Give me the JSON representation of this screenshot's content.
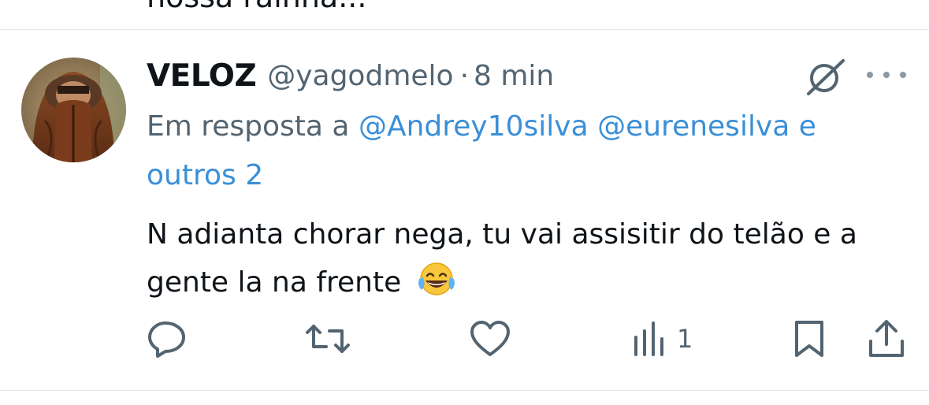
{
  "previous_tweet": {
    "text_fragment": "nossa rainha..."
  },
  "tweet": {
    "author": {
      "display_name": "VELOZ",
      "handle": "@yagodmelo"
    },
    "separator": "·",
    "time": "8 min",
    "reply_prefix": "Em resposta a",
    "reply_mentions": [
      "@Andrey10silva",
      "@eurenesilva"
    ],
    "reply_and": "e",
    "reply_others": "outros 2",
    "text": "N adianta chorar nega, tu vai assisitir do telão e a gente la na frente",
    "text_emoji": "😂"
  },
  "actions": {
    "reply_icon": "reply-bubble-icon",
    "retweet_icon": "retweet-icon",
    "like_icon": "heart-icon",
    "views_icon": "views-bar-chart-icon",
    "views_count": "1",
    "bookmark_icon": "bookmark-icon",
    "share_icon": "share-upload-icon"
  },
  "colors": {
    "text_primary": "#0f1419",
    "text_secondary": "#536471",
    "link": "#3a8fd8",
    "divider": "#e7e9ea"
  }
}
